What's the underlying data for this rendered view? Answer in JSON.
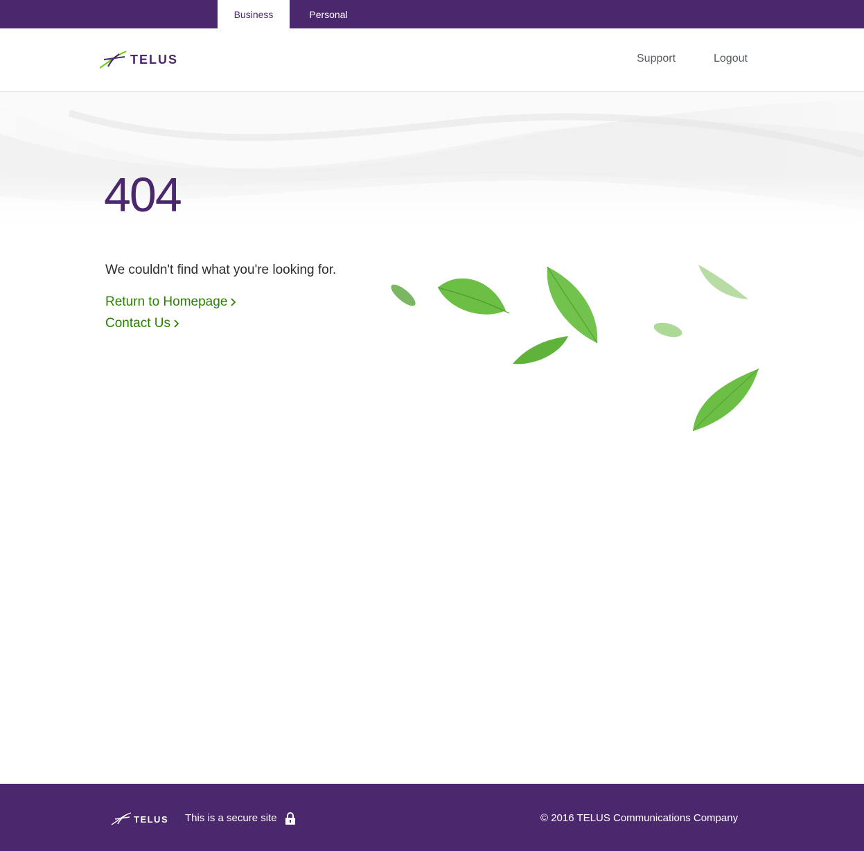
{
  "segments": {
    "business_label": "Business",
    "personal_label": "Personal",
    "active": "Business"
  },
  "header": {
    "logo_text": "TELUS",
    "support_label": "Support",
    "logout_label": "Logout"
  },
  "error": {
    "code": "404",
    "message": "We couldn't find what you're looking for.",
    "home_link_label": "Return to Homepage",
    "contact_link_label": "Contact Us"
  },
  "footer": {
    "logo_text": "TELUS",
    "secure_text": "This is a secure site",
    "copyright": "© 2016 TELUS Communications Company"
  },
  "colors": {
    "brand_purple": "#4b286d",
    "link_green": "#2b8000",
    "leaf_green": "#66bb44"
  },
  "icons": [
    "telus-logo-icon",
    "chevron-right-icon",
    "lock-icon",
    "leaf-icon"
  ]
}
